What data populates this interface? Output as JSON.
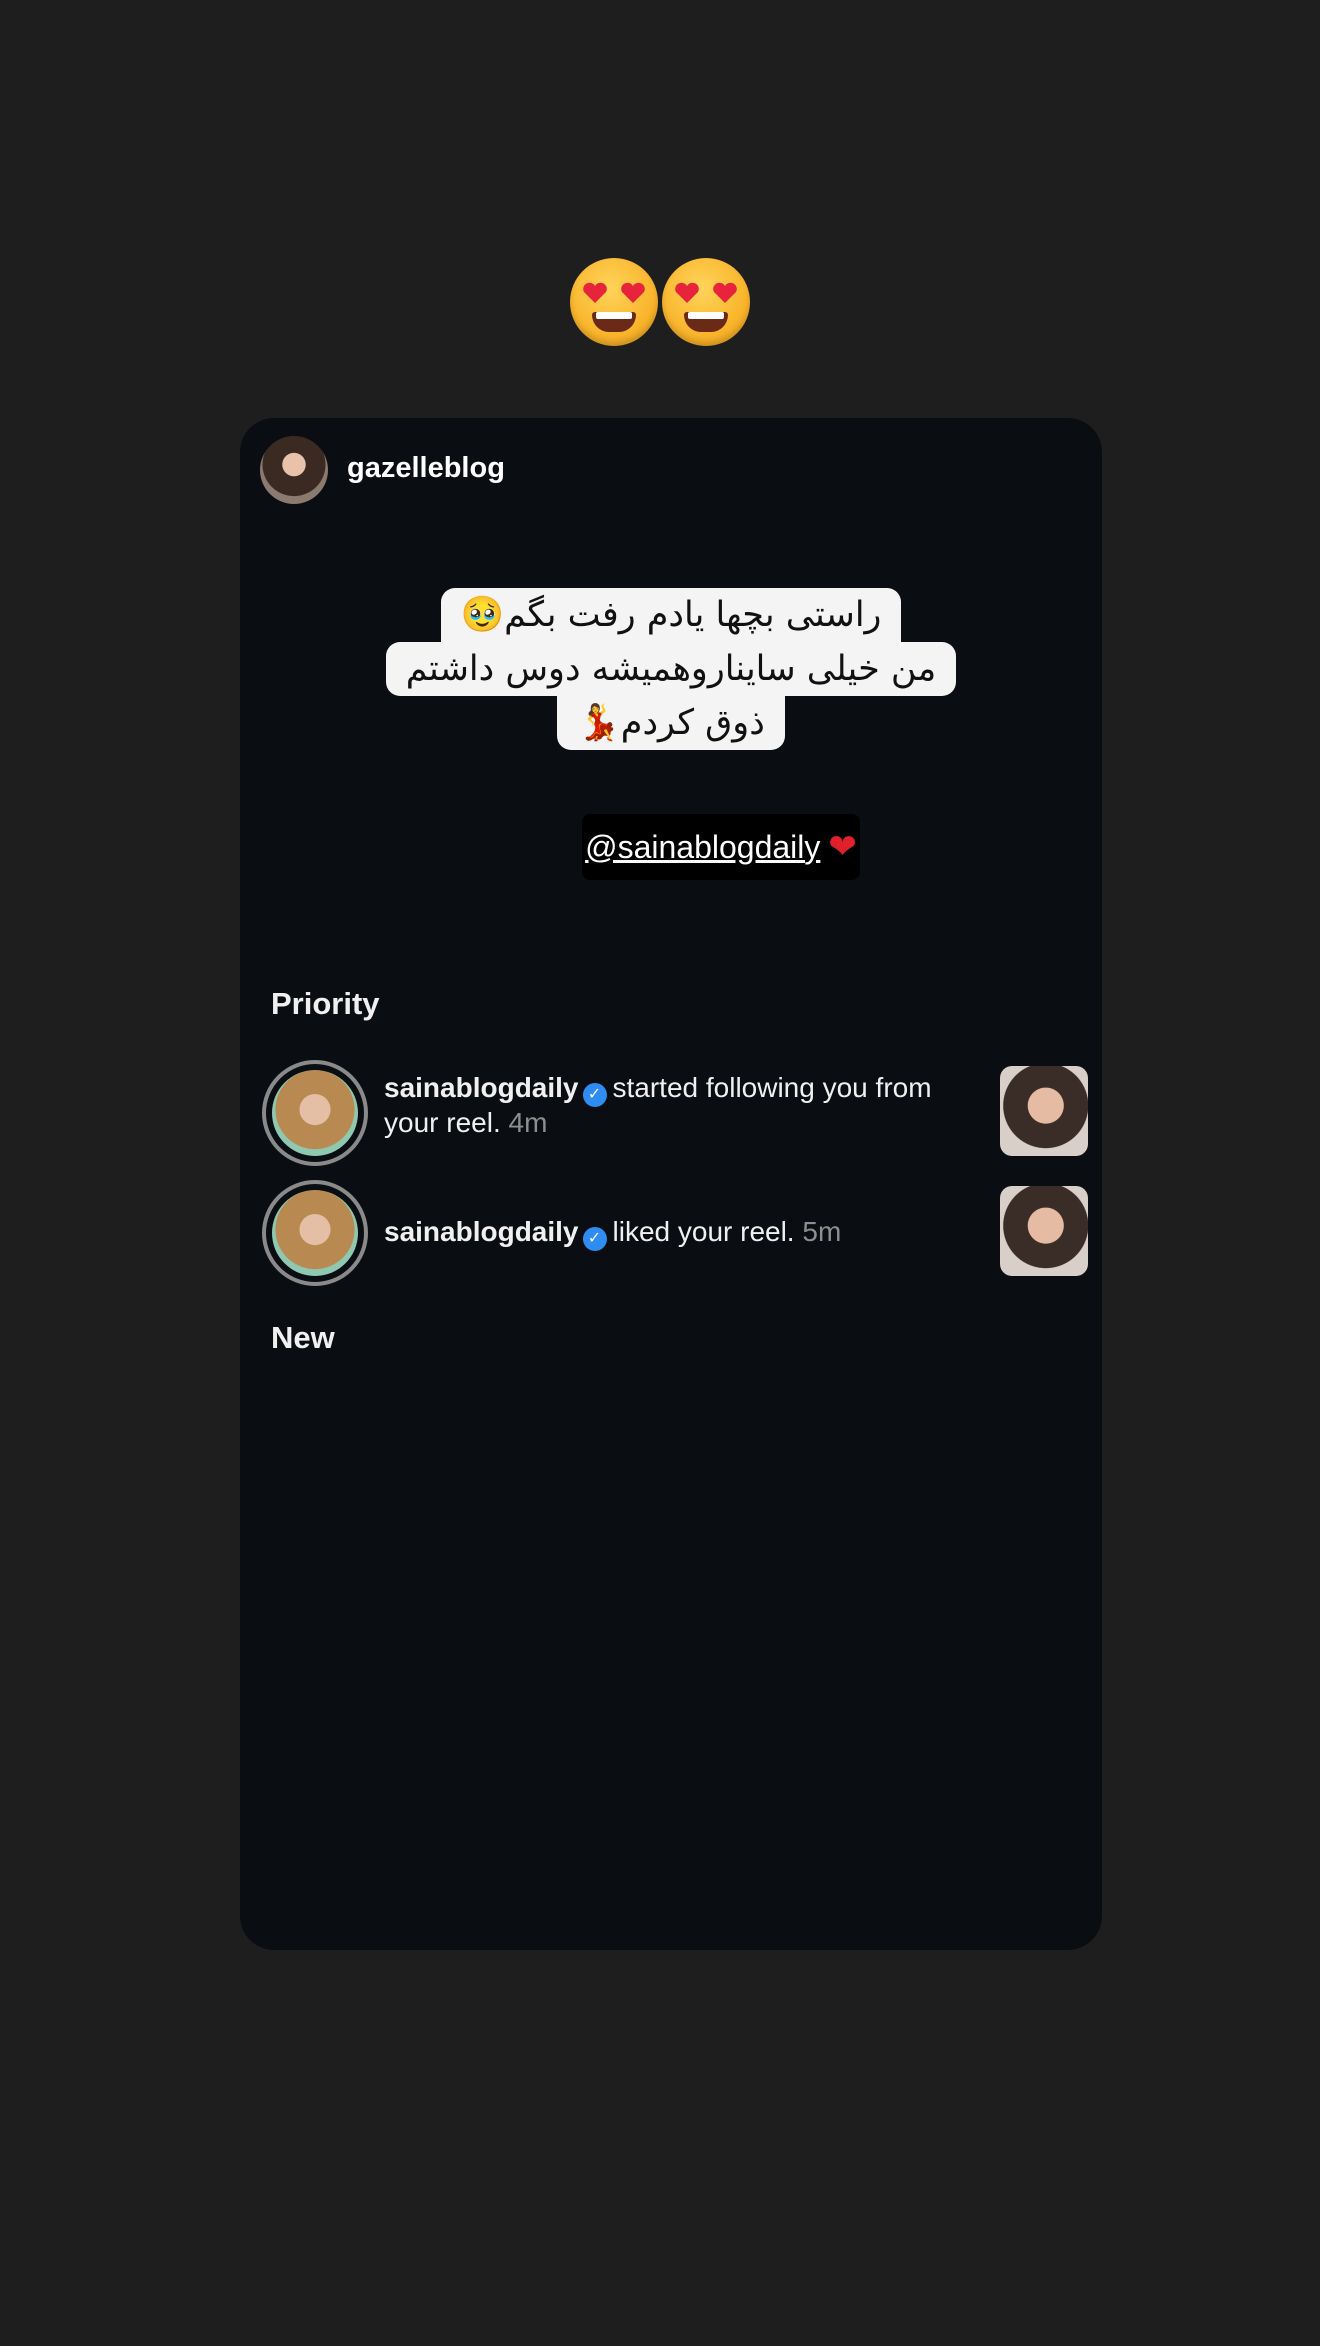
{
  "story": {
    "reaction_emoji": [
      "😍",
      "😍"
    ],
    "author": "gazelleblog",
    "caption_lines": [
      "راستی بچها یادم رفت بگم🥹",
      "من خیلی ساینارو‌همیشه دوس داشتم",
      "ذوق کردم💃"
    ],
    "mention": "@sainablogdaily",
    "mention_emoji": "❤️"
  },
  "screenshot": {
    "priority_label": "Priority",
    "new_label": "New",
    "notifications": [
      {
        "username": "sainablogdaily",
        "action": "started following you from your reel.",
        "time": "4m"
      },
      {
        "username": "sainablogdaily",
        "action": "liked your reel.",
        "time": "5m"
      }
    ]
  },
  "colors": {
    "background": "#1e1e1e",
    "card": "#0a0d12",
    "verified": "#2f8cf0",
    "heart": "#e0202c"
  }
}
